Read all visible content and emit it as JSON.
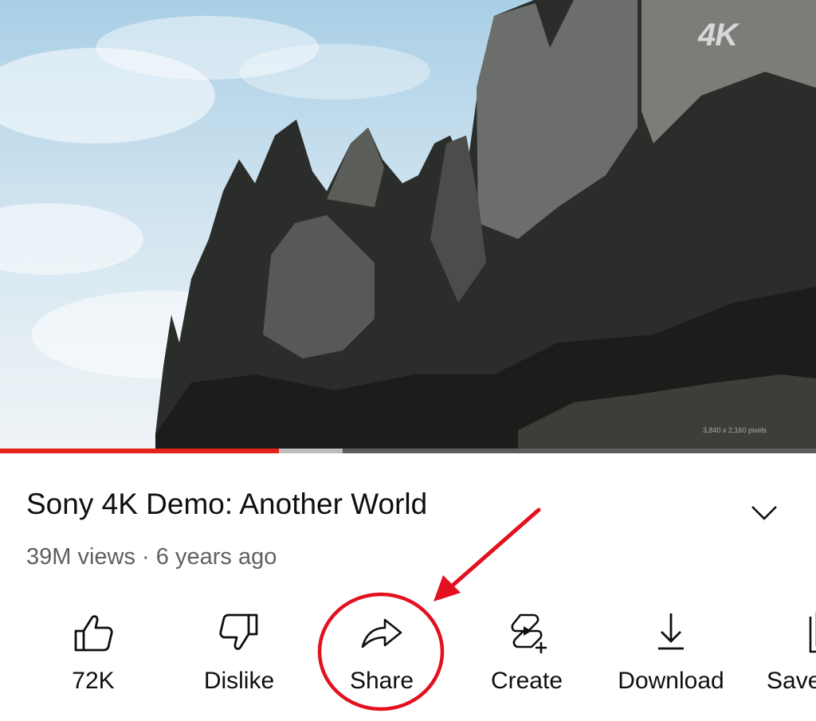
{
  "video": {
    "badge": "4K",
    "caption": "3,840 x 2,160 pixels",
    "progress": {
      "played_fraction": 0.342,
      "buffered_fraction": 0.42
    }
  },
  "title": "Sony 4K Demo: Another World",
  "views": "39M views",
  "separator": " · ",
  "age": "6 years ago",
  "actions": [
    {
      "label": "72K",
      "icon": "thumbs-up-icon"
    },
    {
      "label": "Dislike",
      "icon": "thumbs-down-icon"
    },
    {
      "label": "Share",
      "icon": "share-icon"
    },
    {
      "label": "Create",
      "icon": "remix-icon"
    },
    {
      "label": "Download",
      "icon": "download-icon"
    },
    {
      "label": "Save",
      "icon": "save-icon"
    }
  ],
  "colors": {
    "progress": "#e62117",
    "annotation": "#e3101e",
    "text": "#0f0f0f",
    "secondary": "#606060"
  }
}
